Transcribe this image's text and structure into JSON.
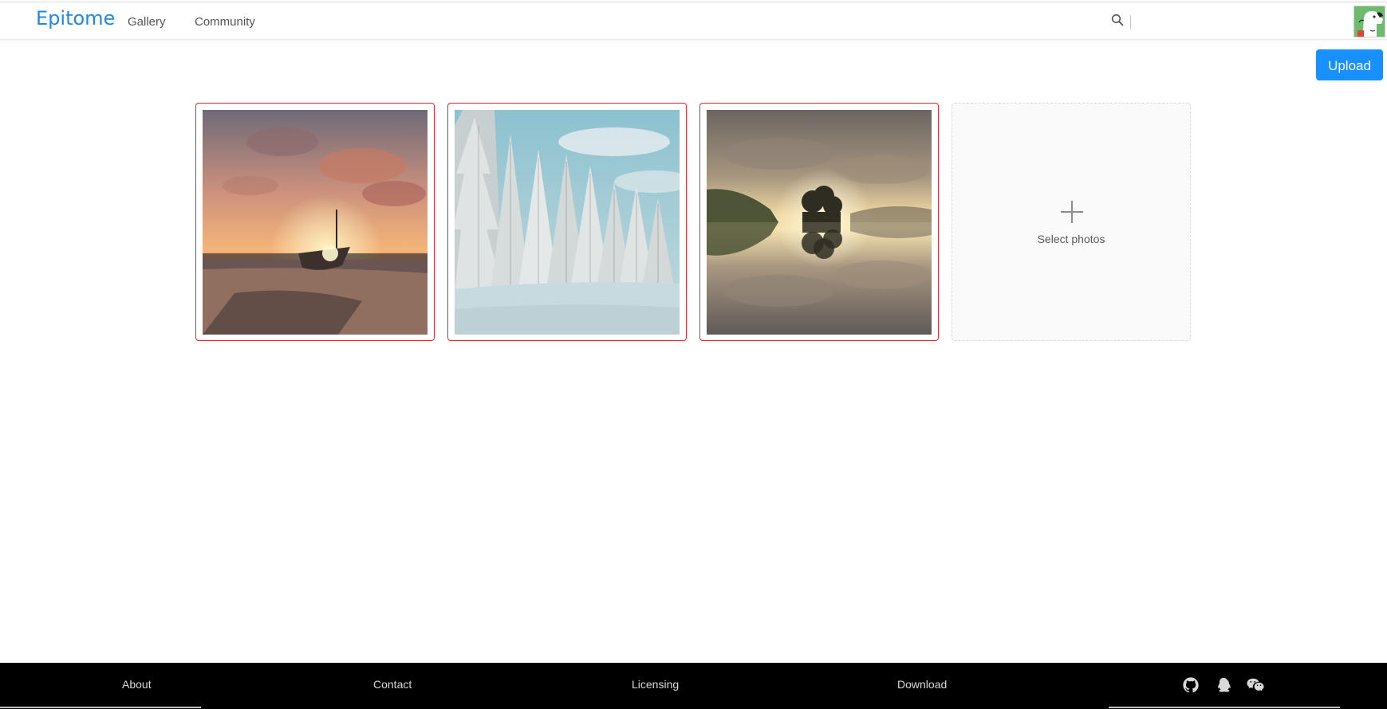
{
  "header": {
    "brand": "Epitome",
    "nav": [
      {
        "label": "Gallery"
      },
      {
        "label": "Community"
      }
    ],
    "search_icon": "search-icon",
    "avatar_icon": "avatar"
  },
  "actions": {
    "upload_label": "Upload"
  },
  "photos": [
    {
      "subject": "boat on beach at sunset",
      "selected": true
    },
    {
      "subject": "snow-covered pine forest",
      "selected": true
    },
    {
      "subject": "lake with tree reflection at sunrise",
      "selected": true
    }
  ],
  "uploader": {
    "icon": "plus-icon",
    "label": "Select photos"
  },
  "footer": {
    "links": [
      {
        "label": "About"
      },
      {
        "label": "Contact"
      },
      {
        "label": "Licensing"
      },
      {
        "label": "Download"
      }
    ],
    "icons": [
      "github-icon",
      "qq-icon",
      "wechat-icon"
    ]
  },
  "colors": {
    "brand": "#1e88e5",
    "primary_button": "#1890ff",
    "selected_border": "#f5222d",
    "footer_bg": "#000000"
  }
}
